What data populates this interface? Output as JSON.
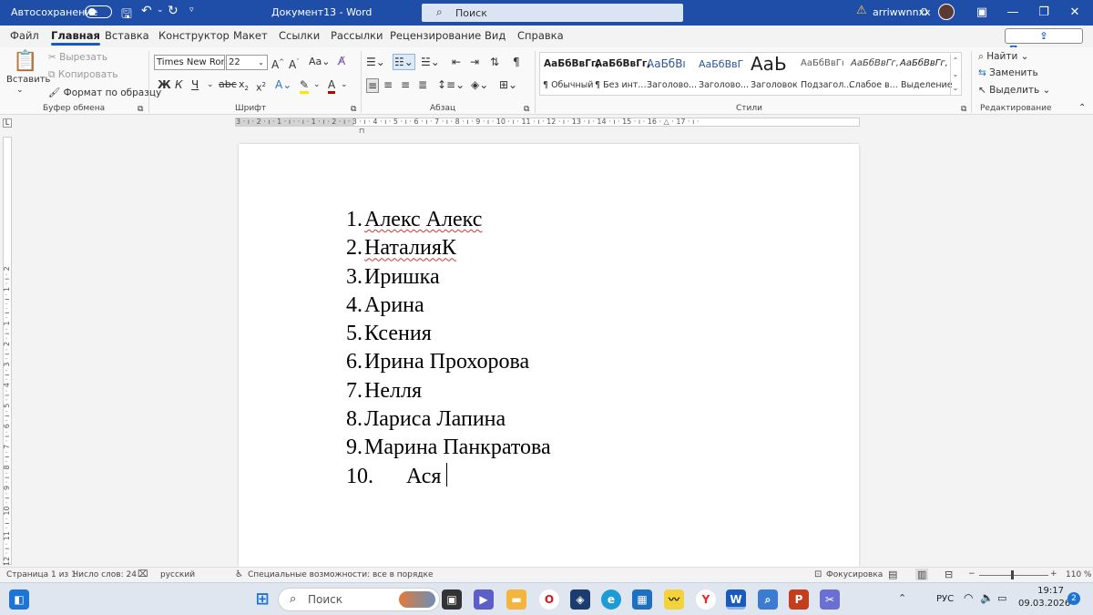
{
  "titlebar": {
    "autosave_label": "Автосохранение",
    "doc_title": "Документ13 - Word",
    "search_placeholder": "Поиск",
    "username": "arriwwnnxx"
  },
  "tabs": [
    "Файл",
    "Главная",
    "Вставка",
    "Конструктор",
    "Макет",
    "Ссылки",
    "Рассылки",
    "Рецензирование",
    "Вид",
    "Справка"
  ],
  "share_label": "Поделиться",
  "clipboard": {
    "paste": "Вставить",
    "cut": "Вырезать",
    "copy": "Копировать",
    "format_painter": "Формат по образцу",
    "group": "Буфер обмена"
  },
  "font": {
    "name": "Times New Rom",
    "size": "22",
    "group": "Шрифт",
    "case": "Aa",
    "bold": "Ж",
    "italic": "К",
    "underline": "Ч",
    "strike": "abc"
  },
  "paragraph": {
    "group": "Абзац"
  },
  "styles": {
    "group": "Стили",
    "items": [
      {
        "preview": "АаБбВвГг,",
        "name": "¶ Обычный"
      },
      {
        "preview": "АаБбВвГг,",
        "name": "¶ Без инт..."
      },
      {
        "preview": "АаБбВı",
        "name": "Заголово..."
      },
      {
        "preview": "АаБбВвГ",
        "name": "Заголово..."
      },
      {
        "preview": "АаЬ",
        "name": "Заголовок"
      },
      {
        "preview": "АаБбВвГı",
        "name": "Подзагол..."
      },
      {
        "preview": "АаБбВвГг,",
        "name": "Слабое в..."
      },
      {
        "preview": "АаБбВвГг,",
        "name": "Выделение"
      }
    ]
  },
  "editing": {
    "find": "Найти",
    "replace": "Заменить",
    "select": "Выделить",
    "group": "Редактирование"
  },
  "ruler_text": "3 · ı · 2 · ı · 1 · ı ·   · ı · 1 · ı · 2 · ı · 3 · ı · 4 · ı · 5 · ı · 6 · ı · 7 · ı · 8 · ı · 9 · ı · 10 · ı · 11 · ı · 12 · ı · 13 · ı · 14 · ı · 15 · ı · 16 · △ · 17 · ı ·",
  "vruler_text": "12 · ı · 11 · ı · 10 · ı · 9 · ı · 8 · ı · 7 · ı · 6 · ı · 5 · ı · 4 · ı · 3 · ı · 2 · ı · 1 · ı ·   · ı · 1 · ı · 2",
  "document": {
    "items": [
      {
        "num": "1.",
        "text": "Алекс Алекс"
      },
      {
        "num": "2.",
        "text": "НаталияК"
      },
      {
        "num": "3.",
        "text": "Иришка"
      },
      {
        "num": "4.",
        "text": "Арина"
      },
      {
        "num": "5.",
        "text": "Ксения"
      },
      {
        "num": "6.",
        "text": "Ирина Прохорова"
      },
      {
        "num": "7.",
        "text": "Нелля"
      },
      {
        "num": "8.",
        "text": "Лариса Лапина"
      },
      {
        "num": "9.",
        "text": "Марина Панкратова"
      },
      {
        "num": "10.",
        "text": "Ася"
      }
    ]
  },
  "status": {
    "page": "Страница 1 из 1",
    "words": "Число слов: 24",
    "language": "русский",
    "accessibility": "Специальные возможности: все в порядке",
    "focus": "Фокусировка",
    "zoom": "110 %"
  },
  "taskbar": {
    "search": "Поиск",
    "lang": "РУС",
    "time": "19:17",
    "date": "09.03.2026",
    "badge": "2"
  },
  "colors": {
    "titlebar": "#1f4ea8",
    "accent": "#185abd"
  }
}
